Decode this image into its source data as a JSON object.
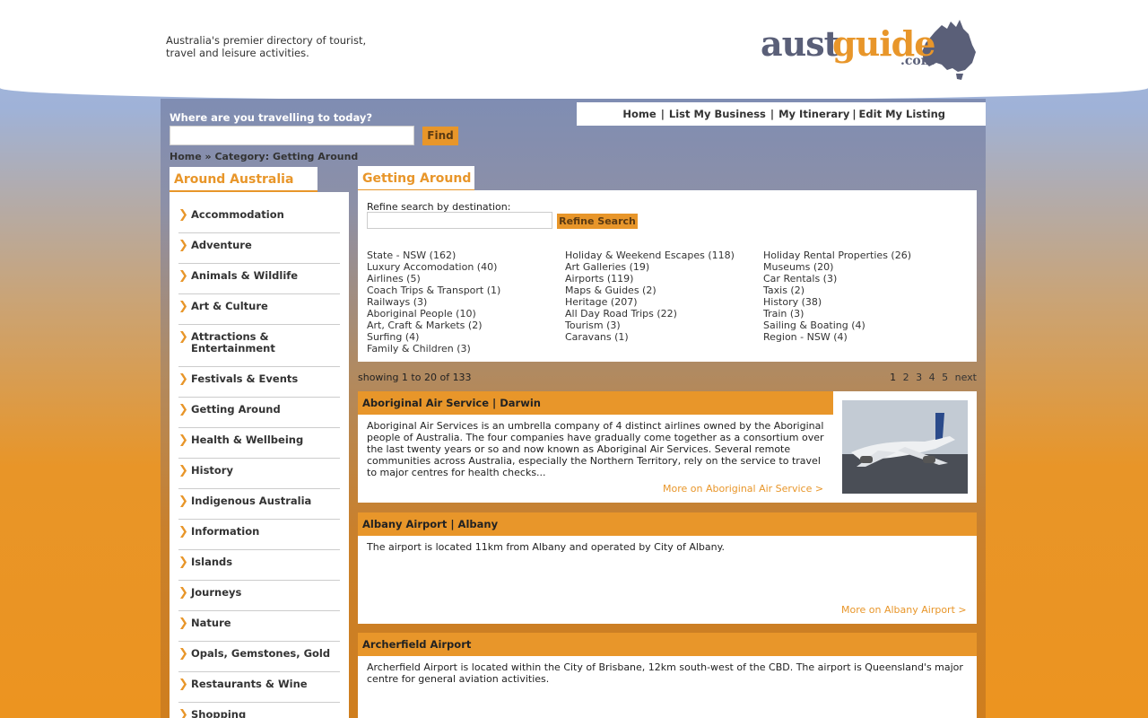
{
  "header": {
    "tagline": "Australia's premier directory of tourist, travel and leisure activities.",
    "logo": {
      "aust": "aust",
      "guide": "guide",
      "com": ".com"
    }
  },
  "search": {
    "label": "Where are you travelling to today?",
    "value": "",
    "find_label": "Find"
  },
  "topnav": {
    "items": [
      "Home",
      "List My Business",
      "My Itinerary",
      "Edit My Listing"
    ]
  },
  "breadcrumb": {
    "home": "Home",
    "sep": "»",
    "current": "Category: Getting Around"
  },
  "sidebar": {
    "title": "Around Australia",
    "items": [
      "Accommodation",
      "Adventure",
      "Animals & Wildlife",
      "Art & Culture",
      "Attractions & Entertainment",
      "Festivals & Events",
      "Getting Around",
      "Health & Wellbeing",
      "History",
      "Indigenous Australia",
      "Information",
      "Islands",
      "Journeys",
      "Nature",
      "Opals, Gemstones, Gold",
      "Restaurants & Wine",
      "Shopping"
    ]
  },
  "content": {
    "title": "Getting Around",
    "refine_label": "Refine search by destination:",
    "refine_button": "Refine Search",
    "refine_columns": [
      [
        "State - NSW (162)",
        "Luxury Accomodation (40)",
        "Airlines (5)",
        "Coach Trips & Transport (1)",
        "Railways (3)",
        "Aboriginal People (10)",
        "Art, Craft & Markets (2)",
        "Surfing (4)",
        "Family & Children (3)"
      ],
      [
        "Holiday & Weekend Escapes (118)",
        "Art Galleries (19)",
        "Airports (119)",
        "Maps & Guides (2)",
        "Heritage (207)",
        "All Day Road Trips (22)",
        "Tourism (3)",
        "Caravans (1)"
      ],
      [
        "Holiday Rental Properties (26)",
        "Museums (20)",
        "Car Rentals (3)",
        "Taxis (2)",
        "History (38)",
        "Train (3)",
        "Sailing & Boating (4)",
        "Region - NSW (4)"
      ]
    ],
    "showing": "showing 1 to 20 of 133",
    "pager": [
      "1",
      "2",
      "3",
      "4",
      "5",
      "next"
    ]
  },
  "listings": [
    {
      "name": "Aboriginal Air Service",
      "location": "Darwin",
      "description": "Aboriginal Air Services is an umbrella company of 4 distinct airlines owned by the Aboriginal people of Australia. The four companies have gradually come together as a consortium over the last twenty years or so and now known as Aboriginal Air Services. Several remote communities across Australia, especially the Northern Territory, rely on the service to travel to major centres for health checks...",
      "more": "More on Aboriginal Air Service >"
    },
    {
      "name": "Albany Airport",
      "location": "Albany",
      "description": "The airport is located 11km from Albany and operated by City of Albany.",
      "more": "More on Albany Airport >"
    },
    {
      "name": "Archerfield Airport",
      "location": "",
      "description": "Archerfield Airport is located within the City of Brisbane, 12km south-west of the CBD. The airport is Queensland's major centre for general aviation activities.",
      "more": ""
    }
  ],
  "colors": {
    "accent": "#e8962a",
    "text": "#333333"
  }
}
